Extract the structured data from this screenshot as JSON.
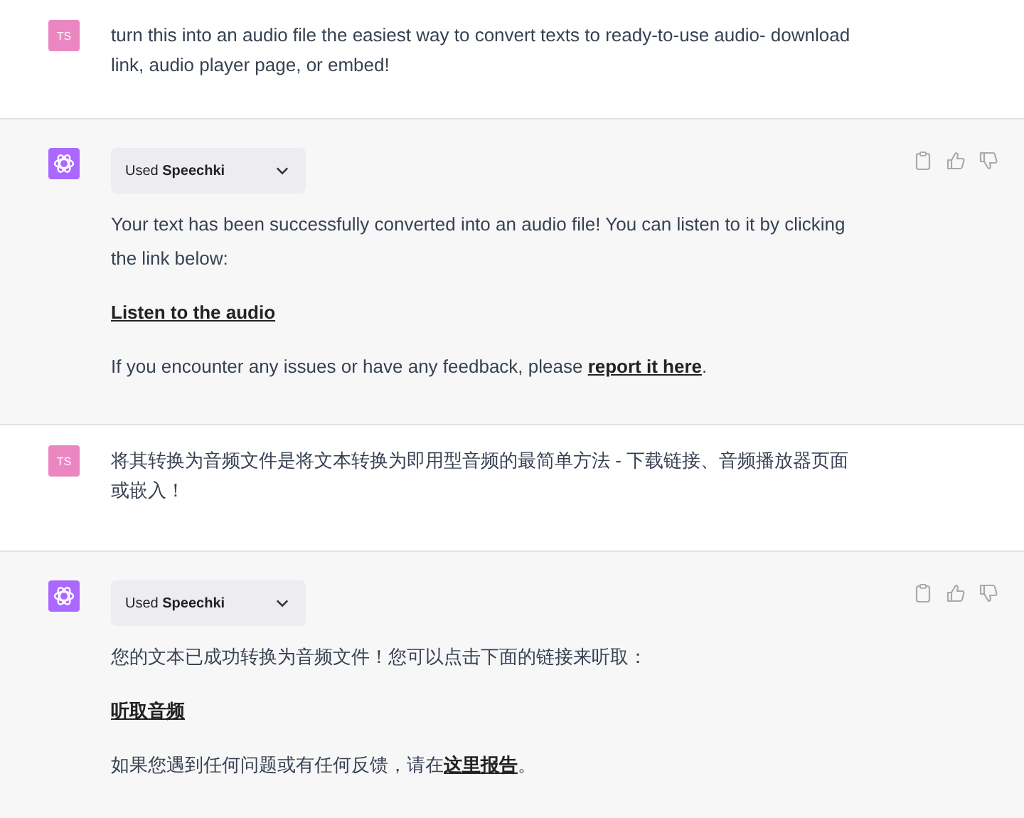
{
  "messages": [
    {
      "kind": "user",
      "avatar": "TS",
      "text": "turn this into an audio file the easiest way to convert texts to ready-to-use audio- download link, audio player page, or embed!"
    },
    {
      "kind": "assistant",
      "plugin": "Used **Speechki**",
      "paragraphs": [
        [
          {
            "kind": "text",
            "text": "Your text has been successfully converted into an audio file! You can listen to it by clicking the link below:"
          }
        ],
        [
          {
            "kind": "link",
            "text": "Listen to the audio"
          }
        ],
        [
          {
            "kind": "text",
            "text": "If you encounter any issues or have any feedback, please "
          },
          {
            "kind": "link",
            "text": "report it here"
          },
          {
            "kind": "text",
            "text": "."
          }
        ]
      ]
    },
    {
      "kind": "user",
      "avatar": "TS",
      "text": "将其转换为音频文件是将文本转换为即用型音频的最简单方法 - 下载链接、音频播放器页面或嵌入！"
    },
    {
      "kind": "assistant",
      "plugin": "Used **Speechki**",
      "paragraphs": [
        [
          {
            "kind": "text",
            "text": "您的文本已成功转换为音频文件！您可以点击下面的链接来听取："
          }
        ],
        [
          {
            "kind": "link",
            "text": "听取音频"
          }
        ],
        [
          {
            "kind": "text",
            "text": "如果您遇到任何问题或有任何反馈，请在"
          },
          {
            "kind": "link",
            "text": "这里报告"
          },
          {
            "kind": "text",
            "text": "。"
          }
        ]
      ]
    }
  ]
}
